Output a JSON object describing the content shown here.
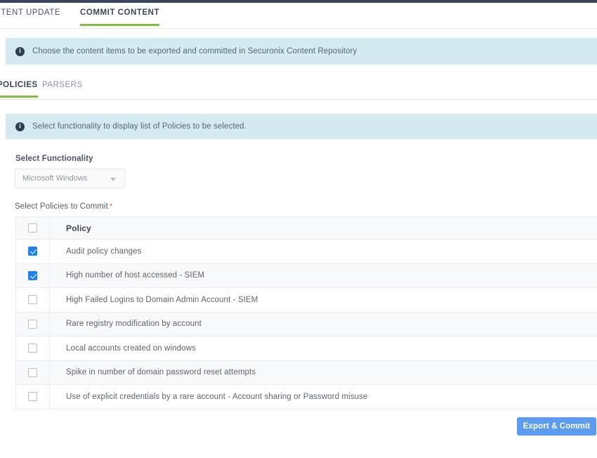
{
  "colors": {
    "accent_green": "#7ac143",
    "banner_bg": "#d6eaf2",
    "checkbox_blue": "#1f7ff5",
    "button_blue": "#5b9bf0",
    "required_red": "#e8503a",
    "top_strip": "#3b4559"
  },
  "primary_tabs": [
    {
      "label": "CONTENT UPDATE",
      "active": false
    },
    {
      "label": "COMMIT CONTENT",
      "active": true
    }
  ],
  "banners": {
    "top": {
      "icon": "info-icon",
      "text": "Choose the content items to be exported and committed in Securonix Content Repository"
    },
    "section": {
      "icon": "info-icon",
      "text": "Select functionality to display list of Policies to be selected."
    }
  },
  "secondary_tabs": [
    {
      "label": "POLICIES",
      "active": true
    },
    {
      "label": "PARSERS",
      "active": false
    }
  ],
  "form": {
    "functionality_label": "Select Functionality",
    "functionality_value": "Microsoft Windows",
    "functionality_caret": "chevron-down-icon",
    "policies_label": "Select Policies to Commit",
    "required_marker": "*"
  },
  "table": {
    "header": {
      "checkbox_checked": false,
      "policy_column": "Policy"
    },
    "rows": [
      {
        "checked": true,
        "policy": "Audit policy changes"
      },
      {
        "checked": true,
        "policy": "High number of host accessed - SIEM"
      },
      {
        "checked": false,
        "policy": "High Failed Logins to Domain Admin Account - SIEM"
      },
      {
        "checked": false,
        "policy": "Rare registry modification by account"
      },
      {
        "checked": false,
        "policy": "Local accounts created on windows"
      },
      {
        "checked": false,
        "policy": "Spike in number of domain password reset attempts"
      },
      {
        "checked": false,
        "policy": "Use of explicit credentials by a rare account - Account sharing or Password misuse"
      }
    ]
  },
  "actions": {
    "export_commit": "Export & Commit"
  }
}
